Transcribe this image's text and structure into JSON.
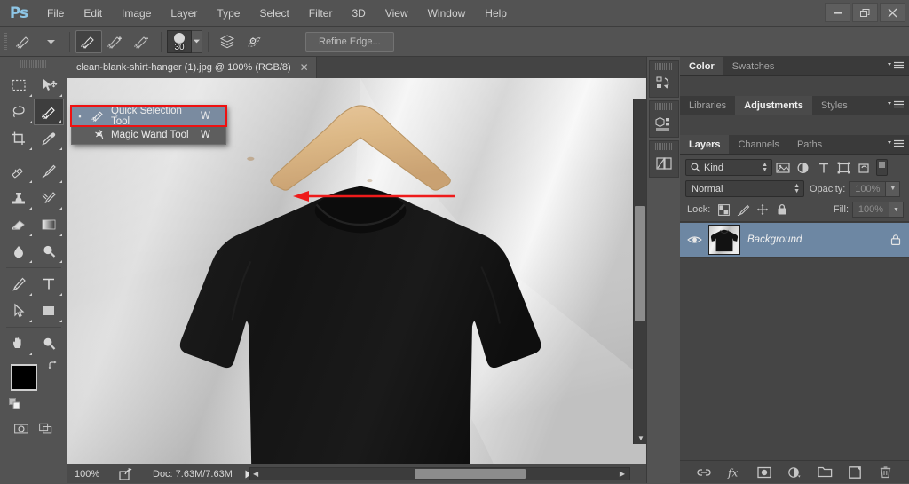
{
  "app": {
    "logo": "Ps",
    "menus": [
      "File",
      "Edit",
      "Image",
      "Layer",
      "Type",
      "Select",
      "Filter",
      "3D",
      "View",
      "Window",
      "Help"
    ],
    "window_controls": [
      "minimize-icon",
      "restore-icon",
      "close-icon"
    ]
  },
  "options_bar": {
    "tool_preset_icon": "quick-selection-preset-icon",
    "preset_dropdown_icon": "chevron-down-icon",
    "modes": [
      {
        "name": "new-selection-icon",
        "active": true
      },
      {
        "name": "add-to-selection-icon",
        "active": false
      },
      {
        "name": "subtract-from-selection-icon",
        "active": false
      }
    ],
    "brush_size": "30",
    "brush_dropdown_icon": "chevron-down-icon",
    "sample_all_layers_icon": "sample-all-layers-icon",
    "auto_enhance_icon": "auto-enhance-icon",
    "refine_edge_label": "Refine Edge..."
  },
  "toolbox": {
    "tools": [
      {
        "name": "rectangular-marquee-tool",
        "icon": "marquee-icon"
      },
      {
        "name": "move-tool",
        "icon": "move-icon"
      },
      {
        "name": "lasso-tool",
        "icon": "lasso-icon"
      },
      {
        "name": "quick-selection-tool",
        "icon": "quick-selection-icon",
        "active": true
      },
      {
        "name": "crop-tool",
        "icon": "crop-icon"
      },
      {
        "name": "eyedropper-tool",
        "icon": "eyedropper-icon"
      },
      {
        "name": "spot-healing-brush-tool",
        "icon": "healing-brush-icon"
      },
      {
        "name": "brush-tool",
        "icon": "brush-icon"
      },
      {
        "name": "clone-stamp-tool",
        "icon": "clone-stamp-icon"
      },
      {
        "name": "history-brush-tool",
        "icon": "history-brush-icon"
      },
      {
        "name": "eraser-tool",
        "icon": "eraser-icon"
      },
      {
        "name": "gradient-tool",
        "icon": "gradient-icon"
      },
      {
        "name": "blur-tool",
        "icon": "blur-drop-icon"
      },
      {
        "name": "dodge-tool",
        "icon": "dodge-icon"
      },
      {
        "name": "pen-tool",
        "icon": "pen-icon"
      },
      {
        "name": "horizontal-type-tool",
        "icon": "type-t-icon"
      },
      {
        "name": "path-selection-tool",
        "icon": "path-arrow-icon"
      },
      {
        "name": "rectangle-tool",
        "icon": "rectangle-shape-icon"
      },
      {
        "name": "hand-tool",
        "icon": "hand-icon"
      },
      {
        "name": "zoom-tool",
        "icon": "magnifier-icon"
      }
    ],
    "foreground_color": "#000000",
    "background_color": "#ffffff",
    "swap_colors_icon": "swap-colors-icon",
    "default_colors_icon": "default-colors-icon",
    "quick_mask_icon": "quick-mask-icon",
    "screen_mode_icon": "screen-mode-icon"
  },
  "flyout_menu": {
    "items": [
      {
        "label": "Quick Selection Tool",
        "shortcut": "W",
        "selected": true,
        "icon": "quick-selection-icon",
        "bullet": "▪"
      },
      {
        "label": "Magic Wand Tool",
        "shortcut": "W",
        "selected": false,
        "icon": "magic-wand-icon",
        "bullet": ""
      }
    ],
    "highlight_color": "#ef1111",
    "annotation_arrow": "red-left-arrow"
  },
  "document": {
    "tab_title": "clean-blank-shirt-hanger (1).jpg @ 100% (RGB/8)",
    "close_icon": "close-icon",
    "canvas_description": "black t-shirt on wooden hanger on gray gradient backdrop"
  },
  "status_bar": {
    "zoom": "100%",
    "share_icon": "share-icon",
    "doc_info": "Doc: 7.63M/7.63M",
    "expand_icon": "play-arrow-icon"
  },
  "icon_rail": {
    "panels": [
      {
        "name": "history-panel-icon"
      },
      {
        "name": "3d-panel-icon"
      },
      {
        "name": "properties-panel-icon"
      }
    ]
  },
  "panels": {
    "group_top": {
      "tabs": [
        {
          "label": "Color",
          "active": true
        },
        {
          "label": "Swatches",
          "active": false
        }
      ],
      "menu_icon": "panel-menu-icon"
    },
    "group_mid": {
      "tabs": [
        {
          "label": "Libraries",
          "active": false
        },
        {
          "label": "Adjustments",
          "active": true
        },
        {
          "label": "Styles",
          "active": false
        }
      ],
      "menu_icon": "panel-menu-icon"
    },
    "layers": {
      "tabs": [
        {
          "label": "Layers",
          "active": true
        },
        {
          "label": "Channels",
          "active": false
        },
        {
          "label": "Paths",
          "active": false
        }
      ],
      "menu_icon": "panel-menu-icon",
      "filter_label": "Kind",
      "filter_search_icon": "search-icon",
      "filter_icons": [
        "pixel-layer-filter-icon",
        "adjustment-layer-filter-icon",
        "type-layer-filter-icon",
        "shape-layer-filter-icon",
        "smart-object-filter-icon"
      ],
      "filter_toggle_icon": "filter-toggle-switch",
      "blend_mode": "Normal",
      "opacity_label": "Opacity:",
      "opacity_value": "100%",
      "lock_label": "Lock:",
      "lock_icons": [
        "lock-transparent-pixels-icon",
        "lock-image-pixels-icon",
        "lock-position-icon",
        "lock-all-icon"
      ],
      "fill_label": "Fill:",
      "fill_value": "100%",
      "rows": [
        {
          "name": "Background",
          "visible": true,
          "locked": true,
          "visibility_icon": "eye-icon",
          "lock_icon": "lock-icon",
          "thumbnail": "black-tshirt-thumbnail"
        }
      ],
      "footer_icons": [
        "link-layers-icon",
        "layer-style-fx-icon",
        "add-layer-mask-icon",
        "new-adjustment-layer-icon",
        "new-group-icon",
        "new-layer-icon",
        "delete-layer-icon"
      ]
    }
  },
  "colors": {
    "chrome": "#535353",
    "panel": "#454545",
    "selection_blue": "#6d87a3",
    "accent_red": "#ef1111",
    "logo_blue": "#8ec6e6"
  }
}
